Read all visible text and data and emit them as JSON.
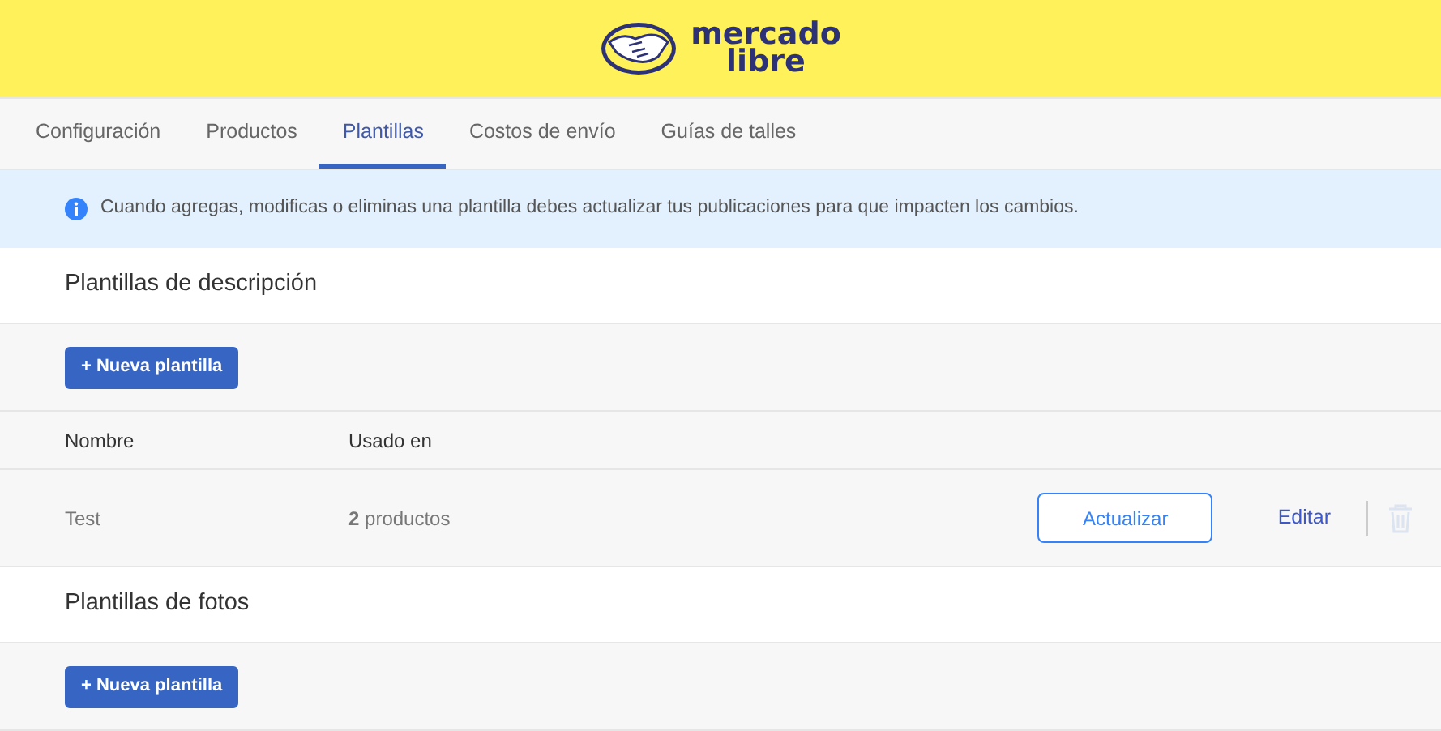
{
  "logo": {
    "line_1": "mercado",
    "line_2": "libre"
  },
  "tabs": [
    {
      "label": "Configuración",
      "selected": false
    },
    {
      "label": "Productos",
      "selected": false
    },
    {
      "label": "Plantillas",
      "selected": true
    },
    {
      "label": "Costos de envío",
      "selected": false
    },
    {
      "label": "Guías de talles",
      "selected": false
    }
  ],
  "notice": "Cuando agregas, modificas o eliminas una plantilla debes actualizar tus publicaciones para que impacten los cambios.",
  "sections": [
    {
      "title": "Plantillas de descripción",
      "button": "+ Nueva plantilla",
      "table": {
        "columns": [
          "Nombre",
          "Usado en"
        ],
        "rows": [
          {
            "name": "Test",
            "used_in": "**2** productos",
            "update": "Actualizar",
            "edit": "Editar",
            "delete_disabled": true
          }
        ]
      }
    },
    {
      "title": "Plantillas de fotos",
      "button": "+ Nueva plantilla"
    }
  ]
}
